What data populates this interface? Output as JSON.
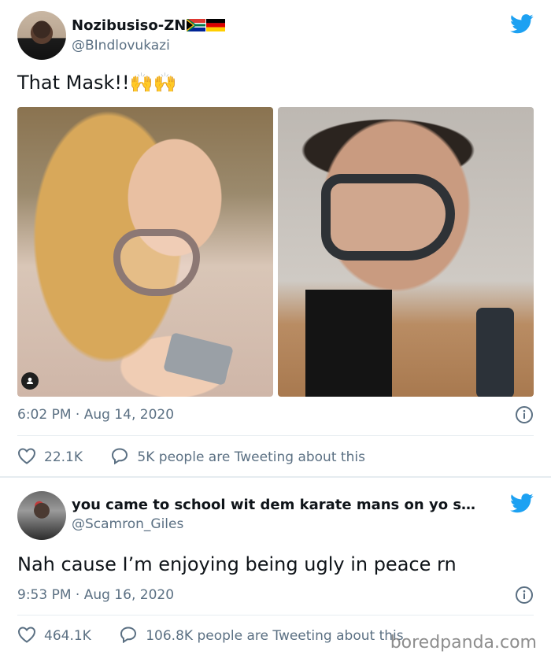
{
  "tweets": [
    {
      "name": "Nozibusiso-ZN",
      "flags": [
        "south-africa-flag",
        "germany-flag"
      ],
      "handle": "@BIndlovukazi",
      "text": "That Mask!!🙌🙌",
      "time": "6:02 PM · Aug 14, 2020",
      "likes": "22.1K",
      "retweets": "5K people are Tweeting about this"
    },
    {
      "name": "you came to school wit dem karate mans on yo s…",
      "handle": "@Scamron_Giles",
      "text": "Nah cause I’m enjoying being ugly in peace rn",
      "time": "9:53 PM · Aug 16, 2020",
      "likes": "464.1K",
      "retweets": "106.8K people are Tweeting about this"
    }
  ],
  "watermark": "boredpanda.com",
  "colors": {
    "twitter_blue": "#1da1f2",
    "secondary_text": "#5b7083"
  }
}
